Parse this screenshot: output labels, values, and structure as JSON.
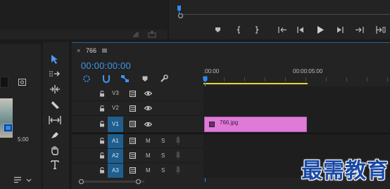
{
  "colors": {
    "background": "#1b1b1b",
    "panel": "#232323",
    "accent_blue": "#2d8ceb",
    "track_target": "#1f5e8e",
    "clip_pink": "#e07ad9",
    "work_area_yellow": "#e8d53a",
    "watermark_blue": "#1a4aa6"
  },
  "program_monitor": {
    "transport_icons": [
      "marker-icon",
      "mark-in-icon",
      "mark-out-icon",
      "go-to-in-icon",
      "step-back-icon",
      "play-icon",
      "step-forward-icon",
      "go-to-out-icon",
      "add-button-icon"
    ]
  },
  "timeline": {
    "sequence_name": "766",
    "timecode": "00:00:00:00",
    "ruler_start": ":00:00",
    "ruler_mid": "00:00:05:00",
    "tracks": [
      {
        "label": "V3",
        "type": "video",
        "targeted": false
      },
      {
        "label": "V2",
        "type": "video",
        "targeted": false
      },
      {
        "label": "V1",
        "type": "video",
        "targeted": true
      },
      {
        "label": "A1",
        "type": "audio",
        "targeted": true
      },
      {
        "label": "A2",
        "type": "audio",
        "targeted": true
      },
      {
        "label": "A3",
        "type": "audio",
        "targeted": true
      }
    ],
    "mute_label": "M",
    "solo_label": "S",
    "clip_name": "766.jpg"
  },
  "project_panel": {
    "thumb_duration": "5:00"
  },
  "tools": [
    "selection-tool-icon",
    "track-select-tool-icon",
    "ripple-edit-tool-icon",
    "razor-tool-icon",
    "slip-tool-icon",
    "pen-tool-icon",
    "hand-tool-icon",
    "type-tool-icon"
  ],
  "watermark": {
    "text": "最需教育"
  }
}
